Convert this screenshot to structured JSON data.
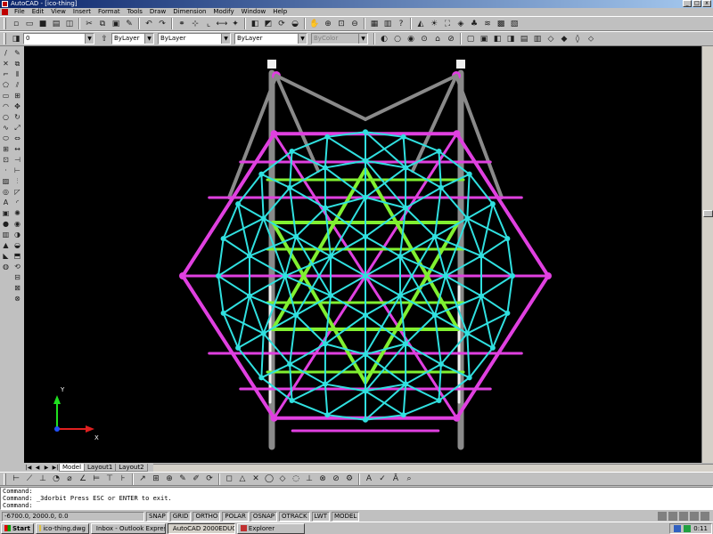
{
  "window": {
    "title": "AutoCAD - [ico-thing]",
    "controls": [
      "_",
      "□",
      "x"
    ]
  },
  "menu": {
    "items": [
      "File",
      "Edit",
      "View",
      "Insert",
      "Format",
      "Tools",
      "Draw",
      "Dimension",
      "Modify",
      "Window",
      "Help"
    ]
  },
  "toolbar_standard": {
    "icons": [
      "new-icon",
      "open-icon",
      "save-icon",
      "print-icon",
      "preview-icon",
      "cut-icon",
      "copy-icon",
      "paste-icon",
      "undo-icon",
      "redo-icon",
      "pan-icon",
      "zoom-icon"
    ]
  },
  "toolbar_properties": {
    "layer_combo": "0",
    "color_combo": "ByLayer",
    "linetype_combo": "ByLayer",
    "lineweight_combo": "ByLayer",
    "plotstyle_combo": "ByColor"
  },
  "viewport": {
    "background": "#000000",
    "colors": {
      "magenta": "#e040e0",
      "cyan": "#30e0e0",
      "green": "#80f030",
      "gray": "#8a8a8a",
      "white": "#f0f0f0"
    },
    "ucs": {
      "x_label": "X",
      "y_label": "Y",
      "x_color": "#e02020",
      "y_color": "#20e020",
      "origin_color": "#2050ff"
    }
  },
  "layout_tabs": [
    "Model",
    "Layout1",
    "Layout2"
  ],
  "command_window": {
    "lines": [
      "Command:",
      "Command: _3dorbit Press ESC or ENTER to exit.",
      "Command:"
    ]
  },
  "status_bar": {
    "coords": "-6700.0,  2000.0, 0.0",
    "toggles": [
      "SNAP",
      "GRID",
      "ORTHO",
      "POLAR",
      "OSNAP",
      "OTRACK",
      "LWT",
      "MODEL"
    ]
  },
  "taskbar": {
    "start_label": "Start",
    "tasks": [
      {
        "label": "ico-thing.dwg",
        "active": false
      },
      {
        "label": "Inbox - Outlook Express",
        "active": false
      },
      {
        "label": "AutoCAD 2000EDUC...",
        "active": true
      },
      {
        "label": "Explorer",
        "active": false
      }
    ],
    "clock": "0:11"
  }
}
